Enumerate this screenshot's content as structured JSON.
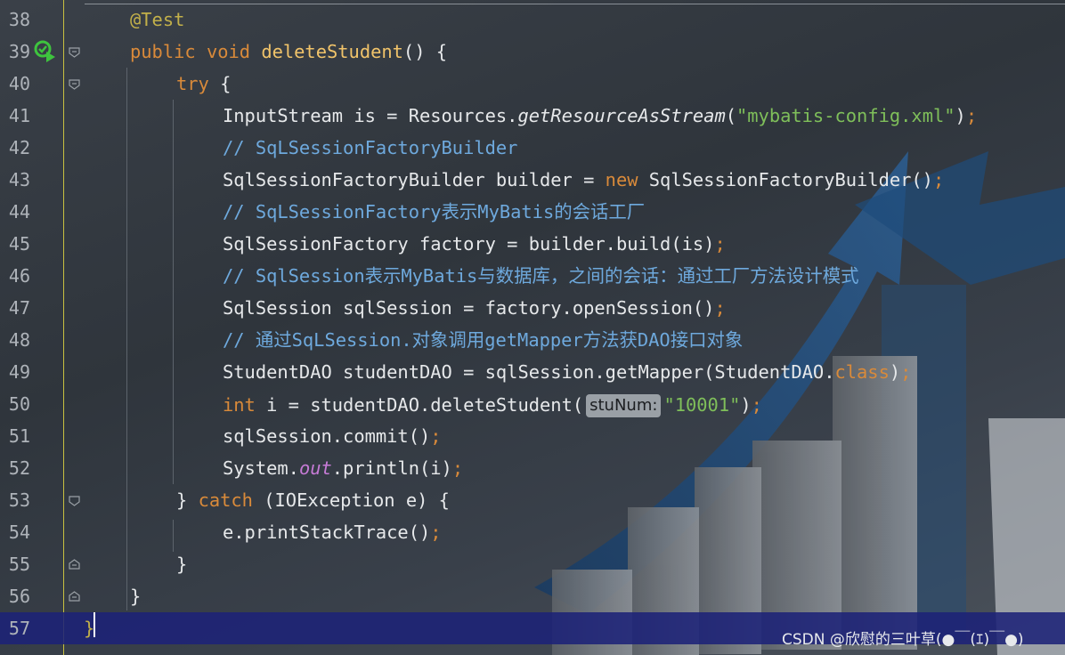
{
  "editor": {
    "lines": [
      {
        "num": "38",
        "tokens": [
          {
            "t": "@Test",
            "c": "ann"
          }
        ]
      },
      {
        "num": "39",
        "tokens": [
          {
            "t": "public ",
            "c": "kw"
          },
          {
            "t": "void ",
            "c": "kw"
          },
          {
            "t": "deleteStudent",
            "c": "fn"
          },
          {
            "t": "() {",
            "c": ""
          }
        ]
      },
      {
        "num": "40",
        "tokens": [
          {
            "t": "try ",
            "c": "kw"
          },
          {
            "t": "{",
            "c": ""
          }
        ]
      },
      {
        "num": "41",
        "tokens": [
          {
            "t": "InputStream is = Resources.",
            "c": ""
          },
          {
            "t": "getResourceAsStream",
            "c": "ital"
          },
          {
            "t": "(",
            "c": ""
          },
          {
            "t": "\"mybatis-config.xml\"",
            "c": "str"
          },
          {
            "t": ")",
            "c": ""
          },
          {
            "t": ";",
            "c": "semi"
          }
        ]
      },
      {
        "num": "42",
        "tokens": [
          {
            "t": "// SqLSessionFactoryBuilder",
            "c": "cmt"
          }
        ]
      },
      {
        "num": "43",
        "tokens": [
          {
            "t": "SqlSessionFactoryBuilder builder = ",
            "c": ""
          },
          {
            "t": "new ",
            "c": "kw"
          },
          {
            "t": "SqlSessionFactoryBuilder()",
            "c": ""
          },
          {
            "t": ";",
            "c": "semi"
          }
        ]
      },
      {
        "num": "44",
        "tokens": [
          {
            "t": "// SqLSessionFactory表示MyBatis的会话工厂",
            "c": "cmt"
          }
        ]
      },
      {
        "num": "45",
        "tokens": [
          {
            "t": "SqlSessionFactory factory = builder.build(is)",
            "c": ""
          },
          {
            "t": ";",
            "c": "semi"
          }
        ]
      },
      {
        "num": "46",
        "tokens": [
          {
            "t": "// SqlSession表示MyBatis与数据库，之间的会话：通过工厂方法设计模式",
            "c": "cmt"
          }
        ]
      },
      {
        "num": "47",
        "tokens": [
          {
            "t": "SqlSession sqlSession = factory.openSession()",
            "c": ""
          },
          {
            "t": ";",
            "c": "semi"
          }
        ]
      },
      {
        "num": "48",
        "tokens": [
          {
            "t": "// 通过SqLSession.对象调用getMapper方法获DAO接口对象",
            "c": "cmt"
          }
        ]
      },
      {
        "num": "49",
        "tokens": [
          {
            "t": "StudentDAO studentDAO = sqlSession.getMapper(StudentDAO.",
            "c": ""
          },
          {
            "t": "class",
            "c": "kw"
          },
          {
            "t": ")",
            "c": ""
          },
          {
            "t": ";",
            "c": "semi"
          }
        ]
      },
      {
        "num": "50",
        "tokens": [
          {
            "t": "int ",
            "c": "kw"
          },
          {
            "t": "i = studentDAO.deleteStudent(",
            "c": ""
          },
          {
            "t": "stuNum:",
            "c": "hint"
          },
          {
            "t": "\"10001\"",
            "c": "str"
          },
          {
            "t": ")",
            "c": ""
          },
          {
            "t": ";",
            "c": "semi"
          }
        ]
      },
      {
        "num": "51",
        "tokens": [
          {
            "t": "sqlSession.commit()",
            "c": ""
          },
          {
            "t": ";",
            "c": "semi"
          }
        ]
      },
      {
        "num": "52",
        "tokens": [
          {
            "t": "System.",
            "c": ""
          },
          {
            "t": "out",
            "c": "field"
          },
          {
            "t": ".println(i)",
            "c": ""
          },
          {
            "t": ";",
            "c": "semi"
          }
        ]
      },
      {
        "num": "53",
        "tokens": [
          {
            "t": "} ",
            "c": ""
          },
          {
            "t": "catch ",
            "c": "kw"
          },
          {
            "t": "(IOException e) {",
            "c": ""
          }
        ]
      },
      {
        "num": "54",
        "tokens": [
          {
            "t": "e.printStackTrace()",
            "c": ""
          },
          {
            "t": ";",
            "c": "semi"
          }
        ]
      },
      {
        "num": "55",
        "tokens": [
          {
            "t": "}",
            "c": ""
          }
        ]
      },
      {
        "num": "56",
        "tokens": [
          {
            "t": "}",
            "c": ""
          }
        ]
      },
      {
        "num": "57",
        "tokens": [
          {
            "t": "}",
            "c": "ann"
          }
        ]
      }
    ],
    "current_line": "57"
  },
  "watermark": "CSDN @欣慰的三叶草(●￣(ｴ)￣●)",
  "colors": {
    "keyword": "#d98a3a",
    "string": "#7fbf5a",
    "comment": "#6ea9dd",
    "method_decl": "#f0c36a",
    "annotation": "#c2b04a",
    "static_field": "#c67bd6",
    "current_line": "#1c2278"
  },
  "icons": [
    "run-test-icon",
    "fold-icon"
  ]
}
